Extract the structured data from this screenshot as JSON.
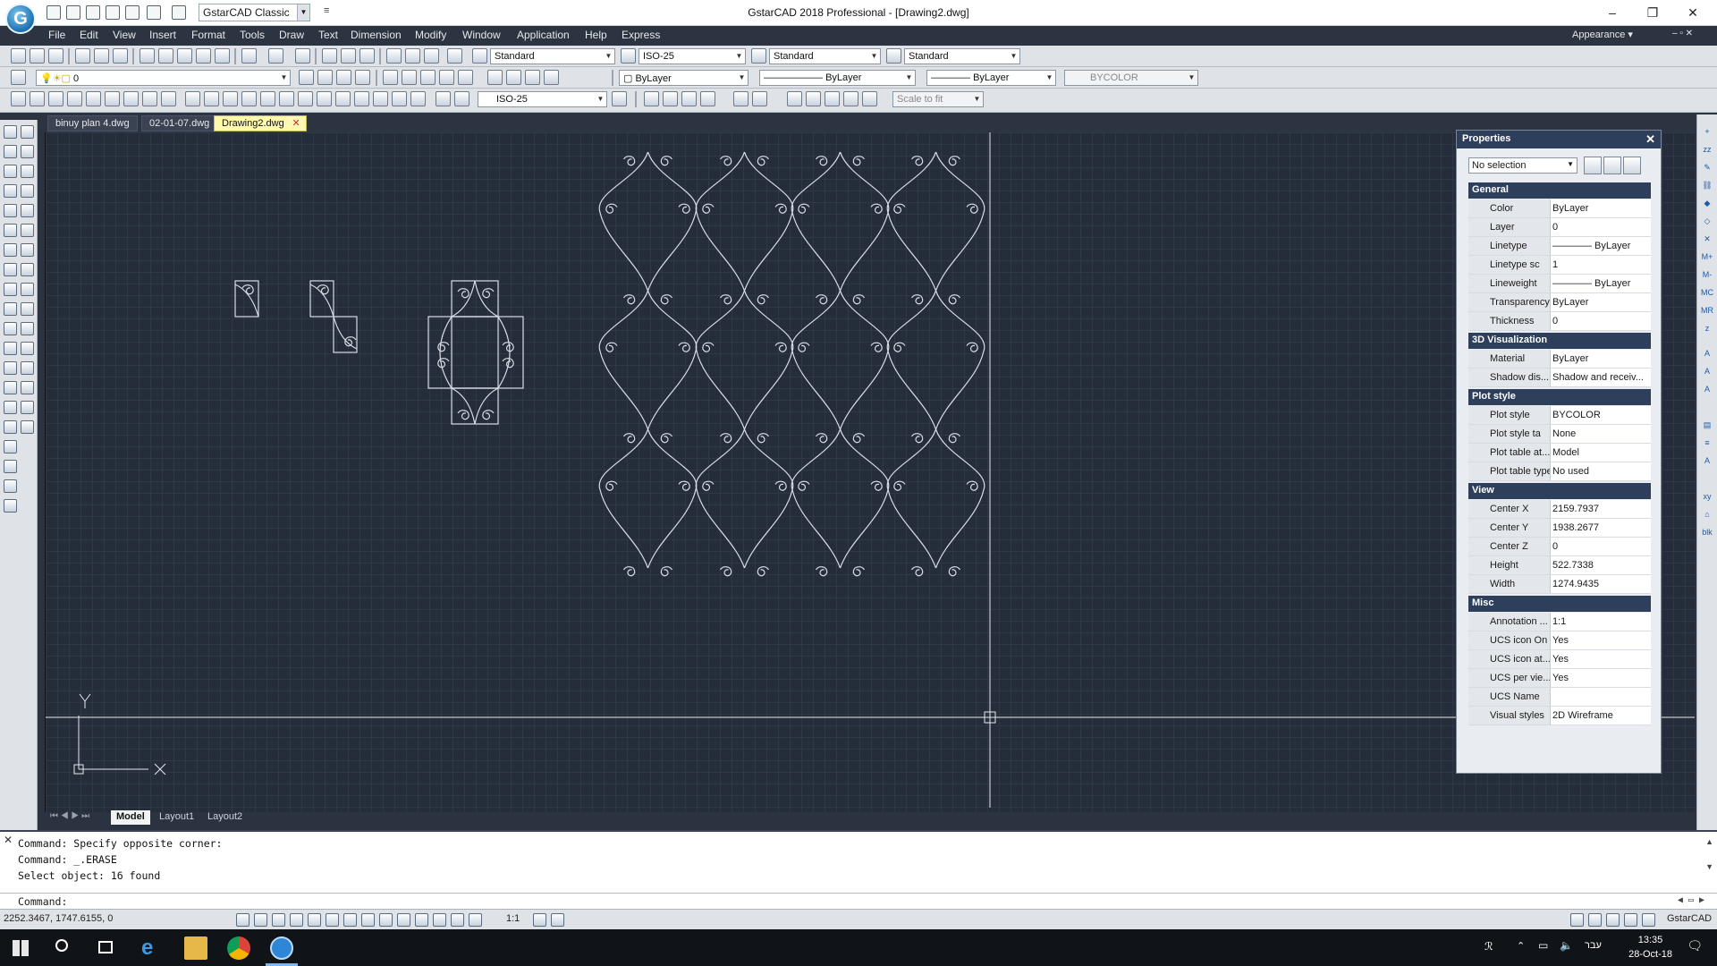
{
  "title_bar": {
    "app_logo": "G",
    "workspace": "GstarCAD Classic",
    "title": "GstarCAD 2018 Professional - [Drawing2.dwg]",
    "min": "–",
    "max": "❐",
    "close": "✕"
  },
  "menu": {
    "items": [
      "File",
      "Edit",
      "View",
      "Insert",
      "Format",
      "Tools",
      "Draw",
      "Text",
      "Dimension",
      "Modify",
      "Window",
      "Application",
      "Help",
      "Express"
    ],
    "appearance": "Appearance ▾",
    "win_controls": "– ▫ ✕"
  },
  "toolbar1": {
    "text_style": "Standard",
    "dim_style": "ISO-25",
    "table_style": "Standard",
    "multileader_style": "Standard"
  },
  "toolbar2": {
    "layer": "0",
    "color": "ByLayer",
    "linetype": "ByLayer",
    "lineweight": "ByLayer",
    "plot_style": "BYCOLOR"
  },
  "toolbar3": {
    "dim_style": "ISO-25",
    "scale": "Scale to fit"
  },
  "doc_tabs": [
    "binuy plan 4.dwg",
    "02-01-07.dwg",
    "Drawing2.dwg"
  ],
  "canvas": {
    "ucs_y": "Y",
    "ucs_x": "X"
  },
  "properties": {
    "title": "Properties",
    "selection": "No selection",
    "sections": [
      {
        "name": "General",
        "rows": [
          {
            "label": "Color",
            "value": "ByLayer"
          },
          {
            "label": "Layer",
            "value": "0"
          },
          {
            "label": "Linetype",
            "value": "———— ByLayer"
          },
          {
            "label": "Linetype sc",
            "value": "1"
          },
          {
            "label": "Lineweight",
            "value": "———— ByLayer"
          },
          {
            "label": "Transparency",
            "value": "ByLayer"
          },
          {
            "label": "Thickness",
            "value": "0"
          }
        ]
      },
      {
        "name": "3D Visualization",
        "rows": [
          {
            "label": "Material",
            "value": "ByLayer"
          },
          {
            "label": "Shadow dis...",
            "value": "Shadow and receiv..."
          }
        ]
      },
      {
        "name": "Plot style",
        "rows": [
          {
            "label": "Plot style",
            "value": "BYCOLOR"
          },
          {
            "label": "Plot style ta",
            "value": "None"
          },
          {
            "label": "Plot table at...",
            "value": "Model"
          },
          {
            "label": "Plot table type",
            "value": "No used"
          }
        ]
      },
      {
        "name": "View",
        "rows": [
          {
            "label": "Center X",
            "value": "2159.7937"
          },
          {
            "label": "Center Y",
            "value": "1938.2677"
          },
          {
            "label": "Center Z",
            "value": "0"
          },
          {
            "label": "Height",
            "value": "522.7338"
          },
          {
            "label": "Width",
            "value": "1274.9435"
          }
        ]
      },
      {
        "name": "Misc",
        "rows": [
          {
            "label": "Annotation ...",
            "value": "1:1"
          },
          {
            "label": "UCS icon On",
            "value": "Yes"
          },
          {
            "label": "UCS icon at...",
            "value": "Yes"
          },
          {
            "label": "UCS per vie...",
            "value": "Yes"
          },
          {
            "label": "UCS Name",
            "value": ""
          },
          {
            "label": "Visual styles",
            "value": "2D Wireframe"
          }
        ]
      }
    ]
  },
  "layout_tabs": [
    "Model",
    "Layout1",
    "Layout2"
  ],
  "command": {
    "lines": [
      "Command: Specify opposite corner:",
      "Command: _.ERASE",
      "Select object:  16 found"
    ],
    "prompt": "Command:"
  },
  "status": {
    "coords": "2252.3467, 1747.6155, 0",
    "scale": "1:1",
    "brand": "GstarCAD"
  },
  "taskbar": {
    "lang": "עבר",
    "time": "13:35",
    "date": "28-Oct-18"
  },
  "colors": {
    "canvas_bg": "#252d3a",
    "menu_bg": "#2d3441",
    "panel_header": "#2e3f5c",
    "active_tab": "#fff8b0"
  }
}
